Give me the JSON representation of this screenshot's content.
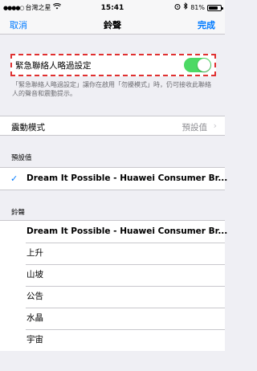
{
  "status": {
    "carrier": "台灣之星",
    "time": "15:41",
    "battery": "81%",
    "battery_level": 0.81
  },
  "nav": {
    "cancel": "取消",
    "title": "鈴聲",
    "done": "完成"
  },
  "bypass": {
    "label": "緊急聯絡人略過設定",
    "enabled": true,
    "footnote": "「緊急聯絡人略過設定」讓你在啟用「勿擾模式」時，仍可接收此聯絡人的聲音和震動提示。"
  },
  "vibration": {
    "label": "震動模式",
    "value": "預設值"
  },
  "default_section": {
    "header": "預設值",
    "selected": "Dream It Possible - Huawei Consumer Br..."
  },
  "ringtone_section": {
    "header": "鈴聲",
    "items": [
      "Dream It Possible - Huawei Consumer Br...",
      "上升",
      "山坡",
      "公告",
      "水晶",
      "宇宙"
    ]
  },
  "colors": {
    "accent": "#007aff",
    "toggle_on": "#4cd964",
    "highlight": "#e03030"
  }
}
